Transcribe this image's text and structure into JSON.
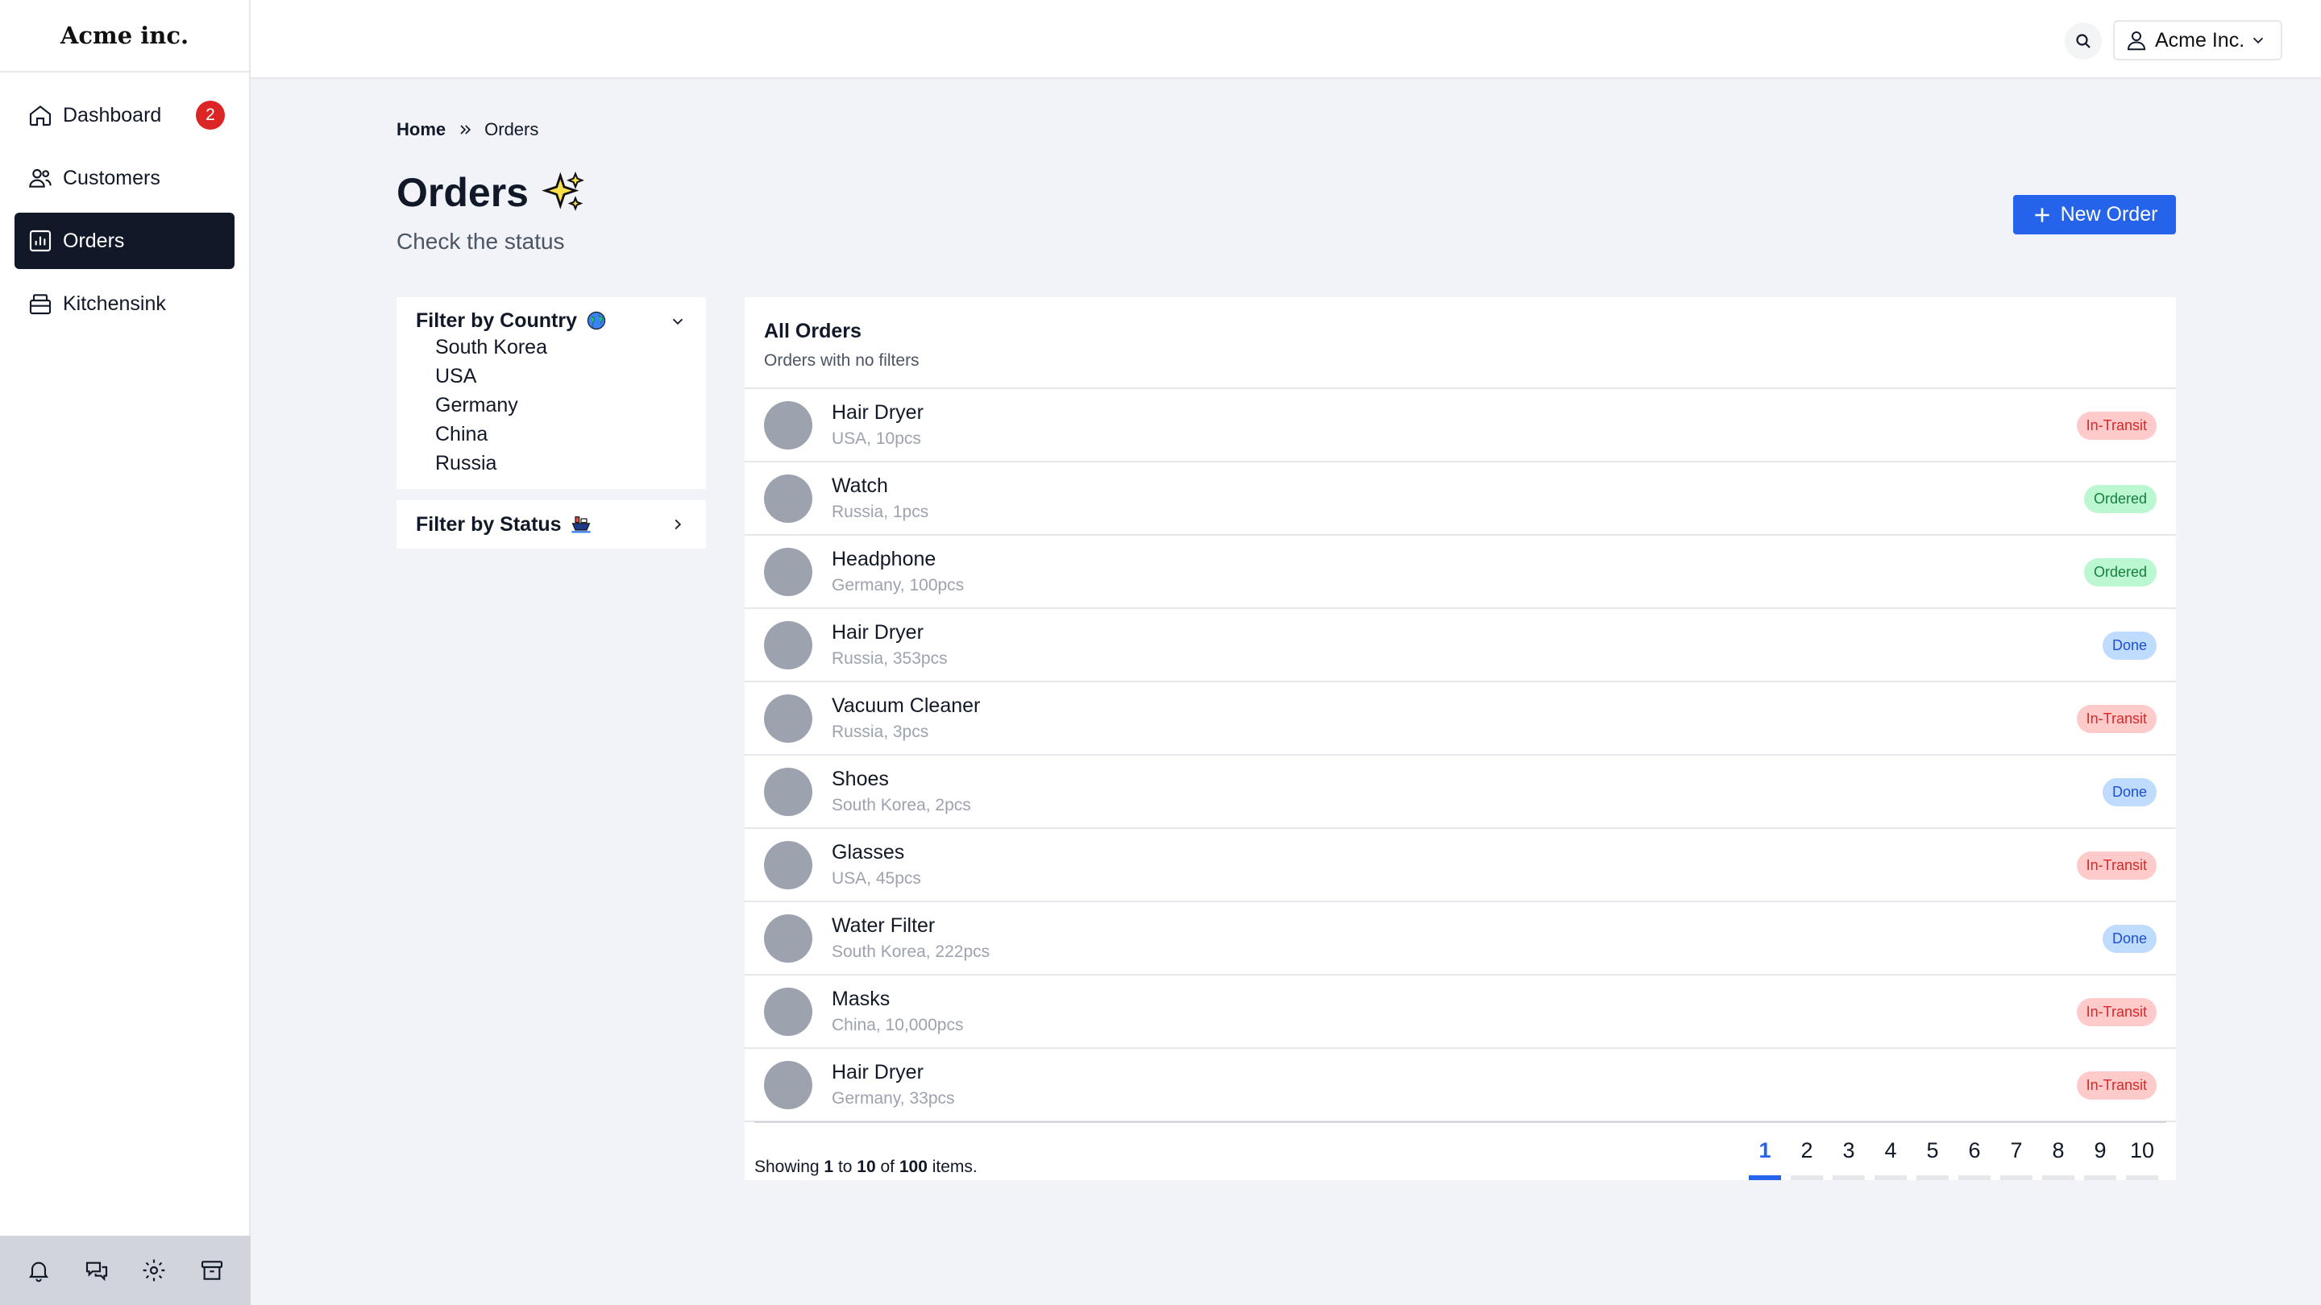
{
  "app": {
    "logo": "Acme inc.",
    "account": "Acme Inc."
  },
  "sidebar": {
    "items": [
      {
        "label": "Dashboard",
        "icon": "home-icon",
        "badge": "2",
        "active": false
      },
      {
        "label": "Customers",
        "icon": "users-icon",
        "active": false
      },
      {
        "label": "Orders",
        "icon": "chart-icon",
        "active": true
      },
      {
        "label": "Kitchensink",
        "icon": "archive-icon",
        "active": false
      }
    ],
    "footer_icons": [
      "bell-icon",
      "chat-icon",
      "gear-icon",
      "archive-box-icon"
    ]
  },
  "breadcrumb": {
    "home": "Home",
    "current": "Orders"
  },
  "page": {
    "title": "Orders",
    "subtitle": "Check the status",
    "new_order_label": "New Order"
  },
  "filters": {
    "country": {
      "label": "Filter by Country",
      "options": [
        "South Korea",
        "USA",
        "Germany",
        "China",
        "Russia"
      ]
    },
    "status": {
      "label": "Filter by Status"
    }
  },
  "orders": {
    "title": "All Orders",
    "subtitle": "Orders with no filters",
    "rows": [
      {
        "name": "Hair Dryer",
        "meta": "USA, 10pcs",
        "status": "In-Transit"
      },
      {
        "name": "Watch",
        "meta": "Russia, 1pcs",
        "status": "Ordered"
      },
      {
        "name": "Headphone",
        "meta": "Germany, 100pcs",
        "status": "Ordered"
      },
      {
        "name": "Hair Dryer",
        "meta": "Russia, 353pcs",
        "status": "Done"
      },
      {
        "name": "Vacuum Cleaner",
        "meta": "Russia, 3pcs",
        "status": "In-Transit"
      },
      {
        "name": "Shoes",
        "meta": "South Korea, 2pcs",
        "status": "Done"
      },
      {
        "name": "Glasses",
        "meta": "USA, 45pcs",
        "status": "In-Transit"
      },
      {
        "name": "Water Filter",
        "meta": "South Korea, 222pcs",
        "status": "Done"
      },
      {
        "name": "Masks",
        "meta": "China, 10,000pcs",
        "status": "In-Transit"
      },
      {
        "name": "Hair Dryer",
        "meta": "Germany, 33pcs",
        "status": "In-Transit"
      }
    ],
    "showing": {
      "prefix": "Showing",
      "from": "1",
      "to_word": "to",
      "to": "10",
      "of_word": "of",
      "total": "100",
      "suffix": "items."
    },
    "pages": [
      "1",
      "2",
      "3",
      "4",
      "5",
      "6",
      "7",
      "8",
      "9",
      "10"
    ],
    "current_page": "1"
  },
  "colors": {
    "accent": "#2563eb",
    "sidebar_active": "#111827",
    "badge_red": "#dc2626"
  }
}
